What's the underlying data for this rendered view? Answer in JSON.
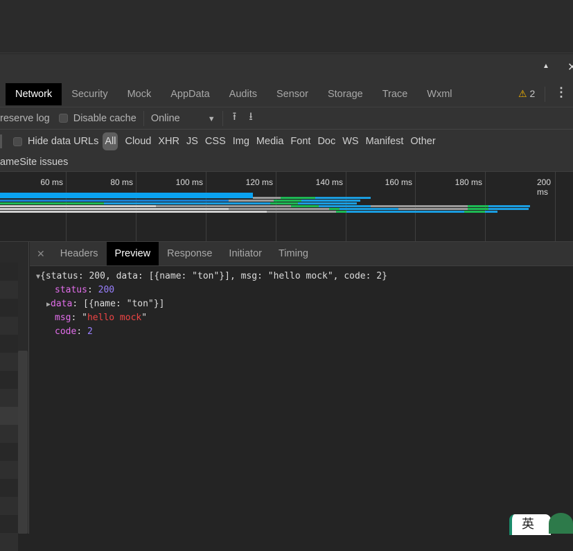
{
  "window": {
    "collapse_icon": "triangle-up-icon",
    "close_icon": "close-icon"
  },
  "tabs": [
    "Network",
    "Security",
    "Mock",
    "AppData",
    "Audits",
    "Sensor",
    "Storage",
    "Trace",
    "Wxml"
  ],
  "active_tab": "Network",
  "warnings": {
    "count": "2",
    "icon": "warning-icon",
    "color": "#f5b400"
  },
  "toolbar": {
    "preserve_log": "reserve log",
    "disable_cache": "Disable cache",
    "throttling": "Online"
  },
  "filters": {
    "hide_data_urls": "Hide data URLs",
    "types": [
      "All",
      "Cloud",
      "XHR",
      "JS",
      "CSS",
      "Img",
      "Media",
      "Font",
      "Doc",
      "WS",
      "Manifest",
      "Other"
    ],
    "active": "All"
  },
  "samesite": "ameSite issues",
  "timeline": {
    "ticks": [
      "60 ms",
      "80 ms",
      "100 ms",
      "120 ms",
      "140 ms",
      "160 ms",
      "180 ms",
      "200 ms"
    ]
  },
  "detail_tabs": [
    "Headers",
    "Preview",
    "Response",
    "Initiator",
    "Timing"
  ],
  "active_detail_tab": "Preview",
  "preview": {
    "summary": "{status: 200, data: [{name: \"ton\"}], msg: \"hello mock\", code: 2}",
    "status_key": "status",
    "status_val": "200",
    "data_key": "data",
    "data_val": "[{name: \"ton\"}]",
    "msg_key": "msg",
    "msg_val": "hello mock",
    "code_key": "code",
    "code_val": "2"
  }
}
